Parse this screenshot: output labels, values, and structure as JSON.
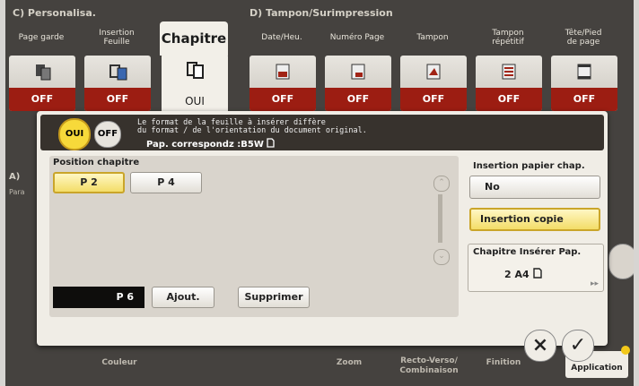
{
  "top": {
    "section_c": "C)  Personalisa.",
    "section_d": "D)  Tampon/Surimpression",
    "tabs": [
      {
        "label": "Page garde",
        "state": "OFF"
      },
      {
        "label": "Insertion\nFeuille",
        "state": "OFF"
      },
      {
        "label": "Chapitre",
        "state": "OUI"
      },
      {
        "label": "Date/Heu.",
        "state": "OFF"
      },
      {
        "label": "Numéro Page",
        "state": "OFF"
      },
      {
        "label": "Tampon",
        "state": "OFF"
      },
      {
        "label": "Tampon\nrépétitif",
        "state": "OFF"
      },
      {
        "label": "Tête/Pied\nde page",
        "state": "OFF"
      }
    ]
  },
  "left_partial": {
    "a": "A)",
    "b": "Para"
  },
  "dialog": {
    "oui": "OUI",
    "off": "OFF",
    "message": "Le format de la feuille à insérer diffère\ndu format / de l'orientation du document original.",
    "message2": "Pap. correspondz :B5W",
    "position_title": "Position chapitre",
    "chapters": [
      "P 2",
      "P 4"
    ],
    "page_input": "P 6",
    "add": "Ajout.",
    "delete": "Supprimer",
    "scroll_up": "⌃",
    "scroll_down": "⌄",
    "insertion_title": "Insertion papier chap.",
    "no": "No",
    "insert_copy": "Insertion copie",
    "chapter_paper_title": "Chapitre Insérer Pap.",
    "chapter_paper_value": "2  A4"
  },
  "bottom": {
    "couleur": "Couleur",
    "zoom": "Zoom",
    "recto_verso": "Recto-Verso/\nCombinaison",
    "finition": "Finition",
    "application": "Application"
  },
  "icons": {
    "cancel": "×",
    "ok": "✓"
  }
}
